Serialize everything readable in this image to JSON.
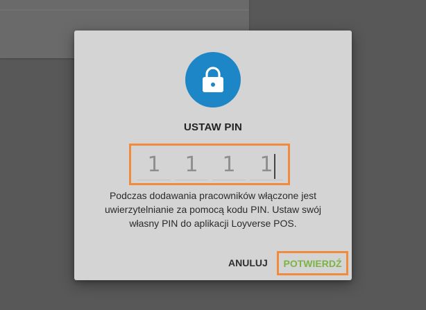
{
  "dialog": {
    "title": "USTAW PIN",
    "message": "Podczas dodawania pracowników włączone jest uwierzytelnianie za pomocą kodu PIN. Ustaw swój własny PIN do aplikacji Loyverse POS.",
    "icon": "lock-icon",
    "pin": {
      "digits": [
        "1",
        "1",
        "1",
        "1"
      ]
    },
    "buttons": {
      "cancel_label": "ANULUJ",
      "confirm_label": "POTWIERDŹ"
    }
  },
  "colors": {
    "overlay": "#585858",
    "dialog_background": "#d4d4d4",
    "icon_circle": "#1c86c6",
    "highlight_outline": "#f08a3c",
    "confirm_text": "#7cb342"
  }
}
